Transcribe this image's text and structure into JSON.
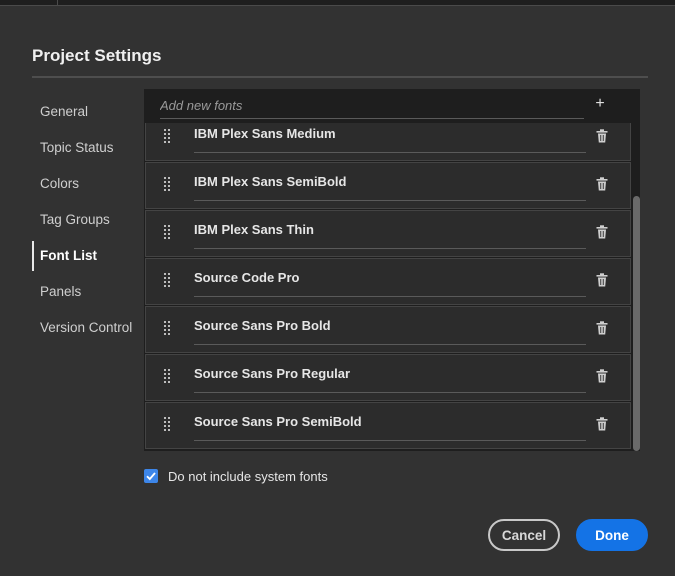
{
  "dialog": {
    "title": "Project Settings"
  },
  "nav": {
    "items": [
      {
        "label": "General",
        "active": false
      },
      {
        "label": "Topic Status",
        "active": false
      },
      {
        "label": "Colors",
        "active": false
      },
      {
        "label": "Tag Groups",
        "active": false
      },
      {
        "label": "Font List",
        "active": true
      },
      {
        "label": "Panels",
        "active": false
      },
      {
        "label": "Version Control",
        "active": false
      }
    ]
  },
  "font_list": {
    "add_placeholder": "Add new fonts",
    "add_icon": "plus-icon",
    "fonts": [
      "IBM Plex Sans Medium",
      "IBM Plex Sans SemiBold",
      "IBM Plex Sans Thin",
      "Source Code Pro",
      "Source Sans Pro Bold",
      "Source Sans Pro Regular",
      "Source Sans Pro SemiBold"
    ]
  },
  "options": {
    "exclude_system_fonts_label": "Do not include system fonts",
    "exclude_system_fonts_checked": true
  },
  "buttons": {
    "cancel": "Cancel",
    "done": "Done"
  },
  "colors": {
    "accent": "#1473e6",
    "checkbox": "#3d86e9",
    "background": "#323232"
  }
}
